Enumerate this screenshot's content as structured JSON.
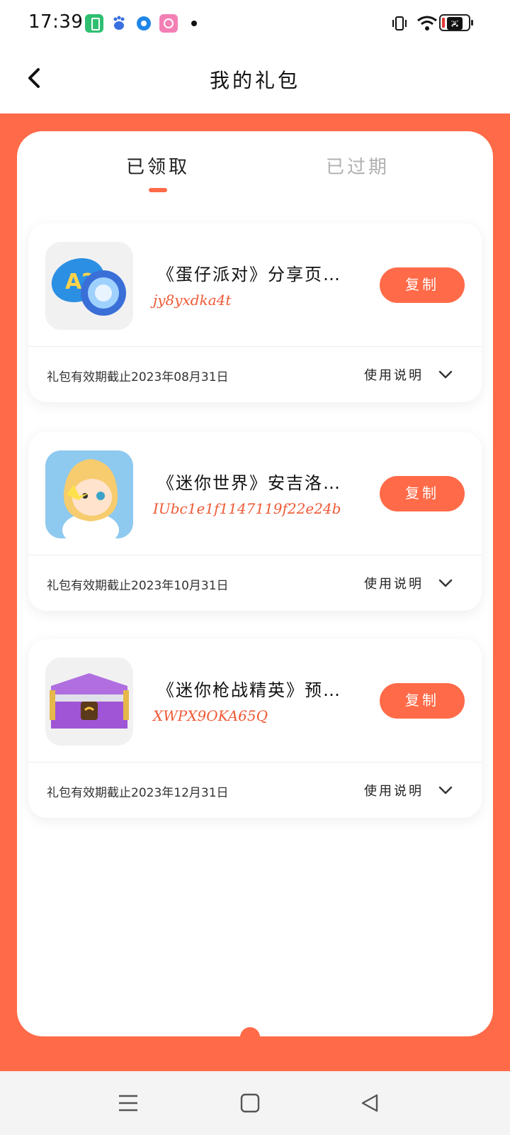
{
  "status_bar": {
    "time": "17:39",
    "battery_level": "9"
  },
  "header": {
    "title": "我的礼包"
  },
  "tabs": [
    {
      "label": "已领取",
      "active": true
    },
    {
      "label": "已过期",
      "active": false
    }
  ],
  "gifts": [
    {
      "name": "《蛋仔派对》分享页…",
      "code": "jy8yxdka4t",
      "copy_label": "复制",
      "expiry": "礼包有效期截止2023年08月31日",
      "usage_label": "使用说明",
      "icon": "bottle-cap-icon"
    },
    {
      "name": "《迷你世界》安吉洛…",
      "code": "IUbc1e1f1147119f22e24b",
      "copy_label": "复制",
      "expiry": "礼包有效期截止2023年10月31日",
      "usage_label": "使用说明",
      "icon": "angel-character-icon"
    },
    {
      "name": "《迷你枪战精英》预…",
      "code": "XWPX9OKA65Q",
      "copy_label": "复制",
      "expiry": "礼包有效期截止2023年12月31日",
      "usage_label": "使用说明",
      "icon": "treasure-chest-icon"
    }
  ],
  "colors": {
    "accent": "#ff6a48",
    "code": "#ee5a37",
    "muted_tab": "#b0b0b0"
  }
}
